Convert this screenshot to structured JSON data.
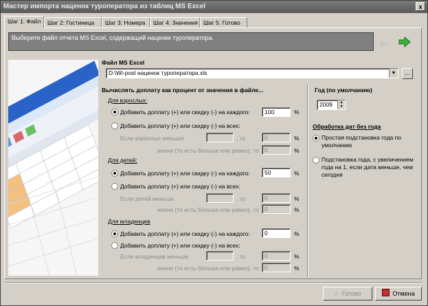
{
  "window": {
    "title": "Мастер импорта наценок туроператора из таблиц MS Excel",
    "close": "x"
  },
  "tabs": [
    {
      "label": "Шаг 1: Файл"
    },
    {
      "label": "Шаг 2: Гостиница"
    },
    {
      "label": "Шаг 3: Номера"
    },
    {
      "label": "Шаг 4: Значения"
    },
    {
      "label": "Шаг 5: Готово"
    }
  ],
  "banner": {
    "text": "Выберите файл отчета MS Excel, содержащий наценки туроператора."
  },
  "file": {
    "label": "Файл MS Excel",
    "path": "D:\\Wi-post наценок туроператора.xls",
    "browse": "..."
  },
  "calc": {
    "heading": "Вычислять доплату как процент от значения в файле..."
  },
  "adults": {
    "heading": "Для взрослых:",
    "opt_each": "Добавить доплату (+) или скидку (-) на каждого:",
    "each_value": "100",
    "opt_all": "Добавить доплату (+) или скидку (-) на всех:",
    "if_less": "Если взрослых меньше",
    "if_less_value": "",
    "then": ", то",
    "then_value": "0",
    "else": "иначе (то есть больше или равно), то",
    "else_value": "0",
    "pct": "%"
  },
  "children": {
    "heading": "Для детей:",
    "opt_each": "Добавить доплату (+) или скидку (-) на каждого:",
    "each_value": "50",
    "opt_all": "Добавить доплату (+) или скидку (-) на всех:",
    "if_less": "Если детей меньше",
    "if_less_value": "",
    "then": ", то",
    "then_value": "0",
    "else": "иначе (то есть больше или равно), то",
    "else_value": "0",
    "pct": "%"
  },
  "infants": {
    "heading": "Для младенцев",
    "opt_each": "Добавить доплату (+) или скидку (-) на каждого:",
    "each_value": "0",
    "opt_all": "Добавить доплату (+) или скидку (-) на всех:",
    "if_less": "Если младенцев меньше",
    "if_less_value": "",
    "then": ", то",
    "then_value": "0",
    "else": "иначе (то есть больше или равно), то",
    "else_value": "0",
    "pct": "%"
  },
  "year": {
    "label": "Год (по умолчанию)",
    "value": "2009"
  },
  "dates": {
    "heading": "Обработка дат без года",
    "opt1": "Простая подстановка года по умолчанию",
    "opt2": "Подстановка года, с увеличением года на 1, если дата меньше, чем сегодня"
  },
  "footer": {
    "done": "Готово",
    "cancel": "Отмена"
  }
}
